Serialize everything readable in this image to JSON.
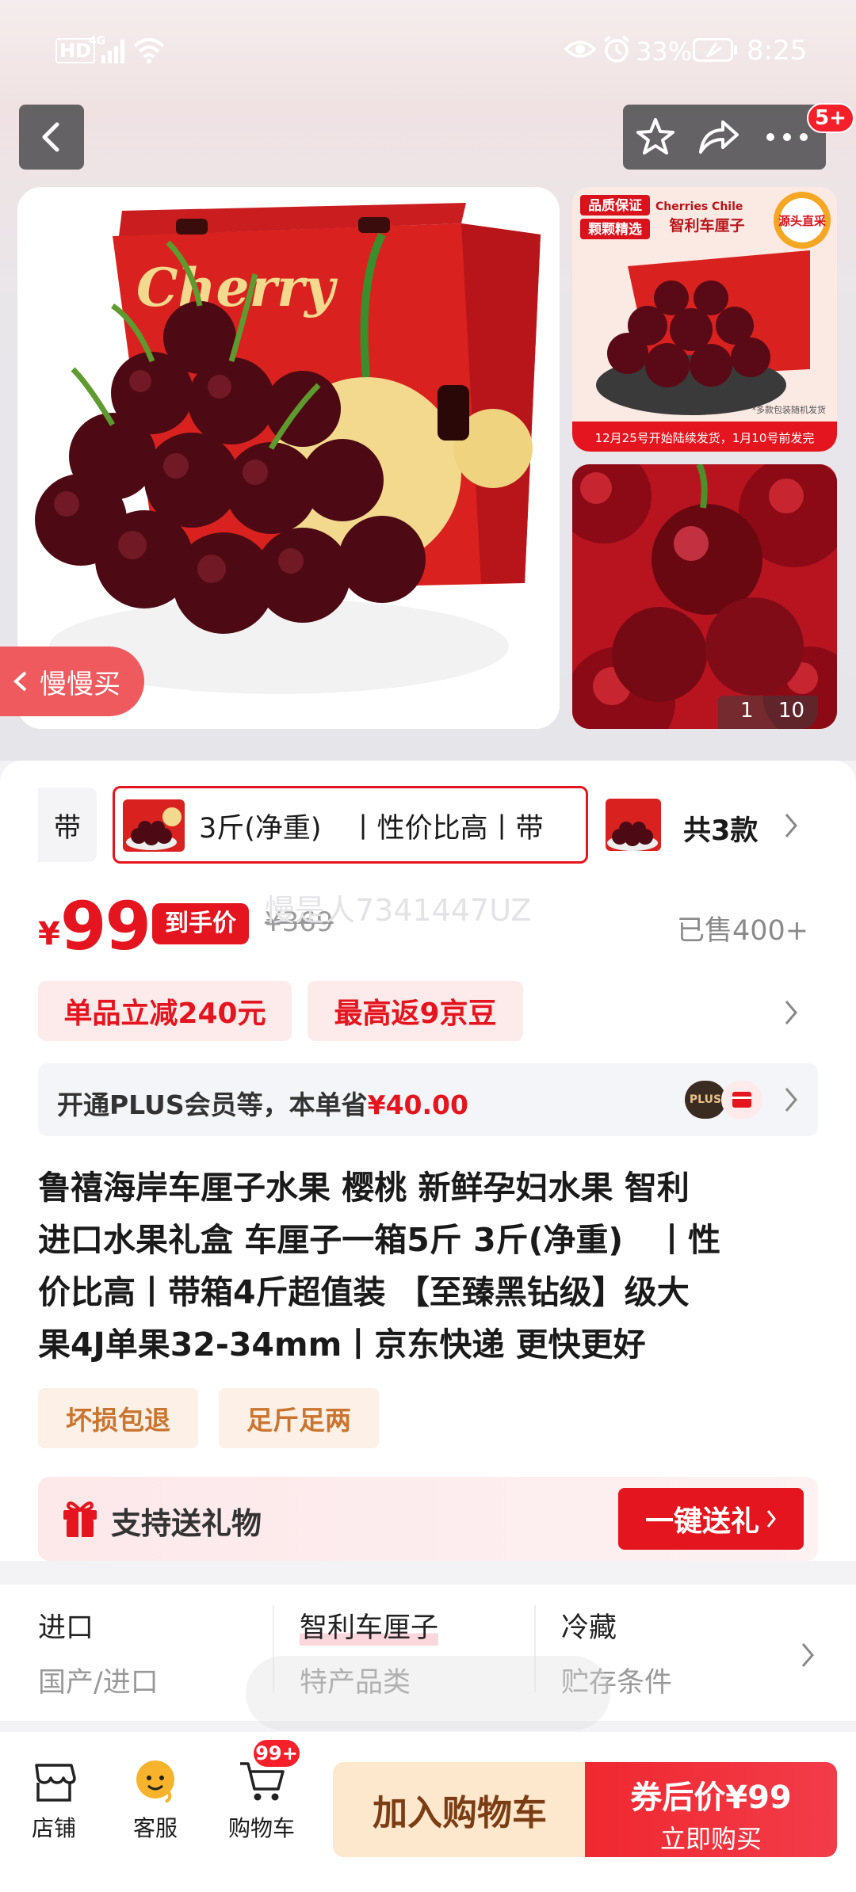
{
  "status": {
    "hd": "HD",
    "net": "4G",
    "battery": "33%",
    "time": "8:25"
  },
  "top": {
    "badge": "5+"
  },
  "gallery": {
    "slow_buy": "慢慢买",
    "counter_cur": "1",
    "counter_total": "10",
    "thumb1": {
      "tag1": "品质保证",
      "tag2": "颗颗精选",
      "brand": "Cherries Chile",
      "title": "智利车厘子",
      "origin": "源头直采",
      "note": "*多款包装随机发货",
      "ship": "12月25号开始陆续发货，1月10号前发完"
    },
    "box_text": "Cherry"
  },
  "sku": {
    "prev": "带",
    "selected": "3斤(净重)　丨性价比高丨带",
    "total": "共3款"
  },
  "price": {
    "symbol": "¥",
    "value": "99",
    "tag": "到手价",
    "original": "¥369",
    "watermark": "慢是人7341447UZ",
    "sold": "已售400+"
  },
  "promos": [
    "单品立减240元",
    "最高返9京豆"
  ],
  "plus": {
    "text": "开通PLUS会员等，本单省",
    "amount": "¥40.00",
    "badge": "PLUS"
  },
  "title": {
    "line1": "鲁禧海岸车厘子水果 樱桃 新鲜孕妇水果 智利",
    "line2": "进口水果礼盒 车厘子一箱5斤 3斤(净重)　丨性",
    "line3": "价比高丨带箱4斤超值装 【至臻黑钻级】级大",
    "line4": "果4J单果32-34mm丨京东快递 更快更好"
  },
  "tags": [
    "坏损包退",
    "足斤足两"
  ],
  "gift": {
    "label": "支持送礼物",
    "button": "一键送礼"
  },
  "specs": [
    {
      "value": "进口",
      "label": "国产/进口"
    },
    {
      "value": "智利车厘子",
      "label": "特产品类"
    },
    {
      "value": "冷藏",
      "label": "贮存条件"
    }
  ],
  "bottom": {
    "shop": "店铺",
    "service": "客服",
    "cart": "购物车",
    "cart_badge": "99+",
    "add_cart": "加入购物车",
    "buy_price": "券后价¥99",
    "buy_now": "立即购买"
  },
  "colors": {
    "red": "#e4151e",
    "pink_bg": "#fde9ea",
    "tag_bg": "#fdf0e6"
  }
}
